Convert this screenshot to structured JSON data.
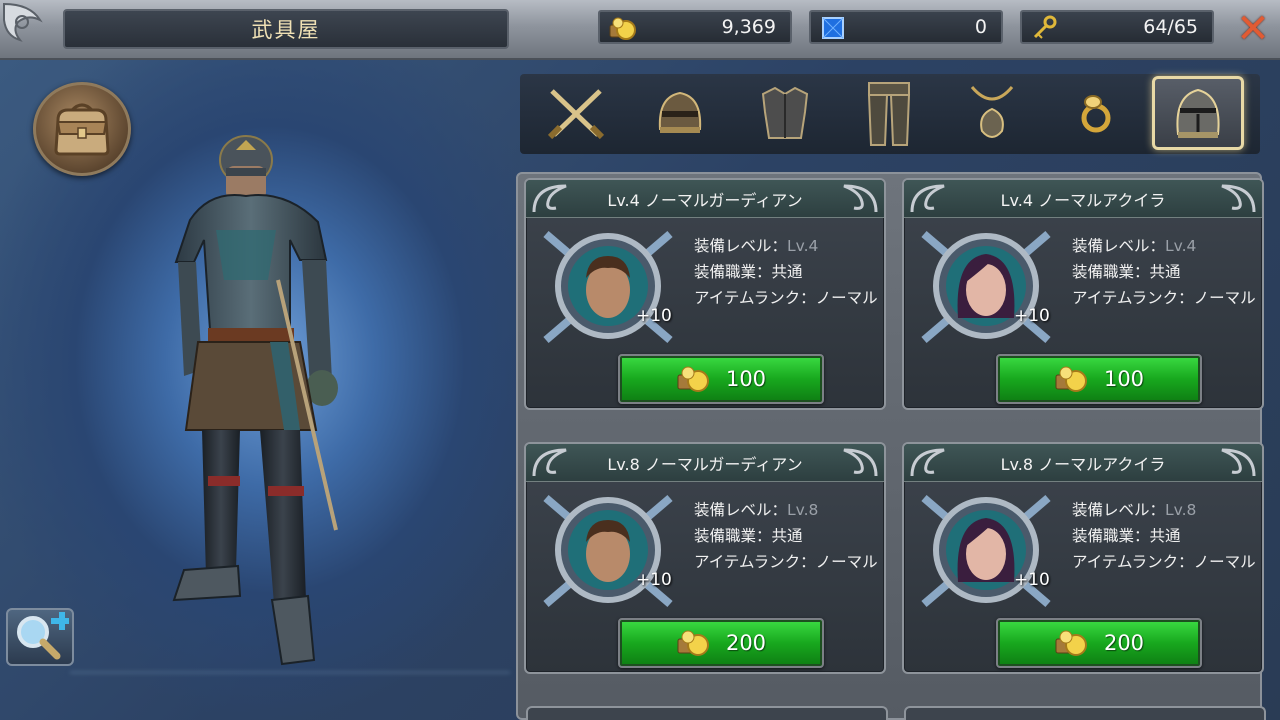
{
  "header": {
    "title": "武具屋",
    "gold": "9,369",
    "gems": "0",
    "keys": "64/65"
  },
  "icons": {
    "gold": "gold-coins-icon",
    "gem": "blue-gem-icon",
    "key": "key-icon",
    "close": "close-icon",
    "bag": "inventory-bag-icon",
    "zoom": "zoom-in-icon"
  },
  "close_symbol": "✕",
  "tabs": [
    {
      "name": "weapon",
      "icon": "crossed-swords-icon"
    },
    {
      "name": "helmet",
      "icon": "helmet-icon"
    },
    {
      "name": "armor",
      "icon": "chest-armor-icon"
    },
    {
      "name": "leggings",
      "icon": "leg-armor-icon"
    },
    {
      "name": "necklace",
      "icon": "necklace-icon"
    },
    {
      "name": "ring",
      "icon": "ring-icon"
    },
    {
      "name": "costume",
      "icon": "knight-helm-icon",
      "active": true
    }
  ],
  "items": [
    {
      "name": "Lv.4 ノーマルガーディアン",
      "stat1_label": "装備レベル：",
      "stat1_value": "Lv.4",
      "stat2": "装備職業：共通",
      "stat3": "アイテムランク：ノーマル",
      "enhance": "+10",
      "price": "100",
      "portrait": "male"
    },
    {
      "name": "Lv.4 ノーマルアクイラ",
      "stat1_label": "装備レベル：",
      "stat1_value": "Lv.4",
      "stat2": "装備職業：共通",
      "stat3": "アイテムランク：ノーマル",
      "enhance": "+10",
      "price": "100",
      "portrait": "female"
    },
    {
      "name": "Lv.8 ノーマルガーディアン",
      "stat1_label": "装備レベル：",
      "stat1_value": "Lv.8",
      "stat2": "装備職業：共通",
      "stat3": "アイテムランク：ノーマル",
      "enhance": "+10",
      "price": "200",
      "portrait": "male"
    },
    {
      "name": "Lv.8 ノーマルアクイラ",
      "stat1_label": "装備レベル：",
      "stat1_value": "Lv.8",
      "stat2": "装備職業：共通",
      "stat3": "アイテムランク：ノーマル",
      "enhance": "+10",
      "price": "200",
      "portrait": "female"
    }
  ],
  "colors": {
    "buy_button": "#18a81e",
    "title_text": "#f0e1b5",
    "close": "#e25b33"
  }
}
